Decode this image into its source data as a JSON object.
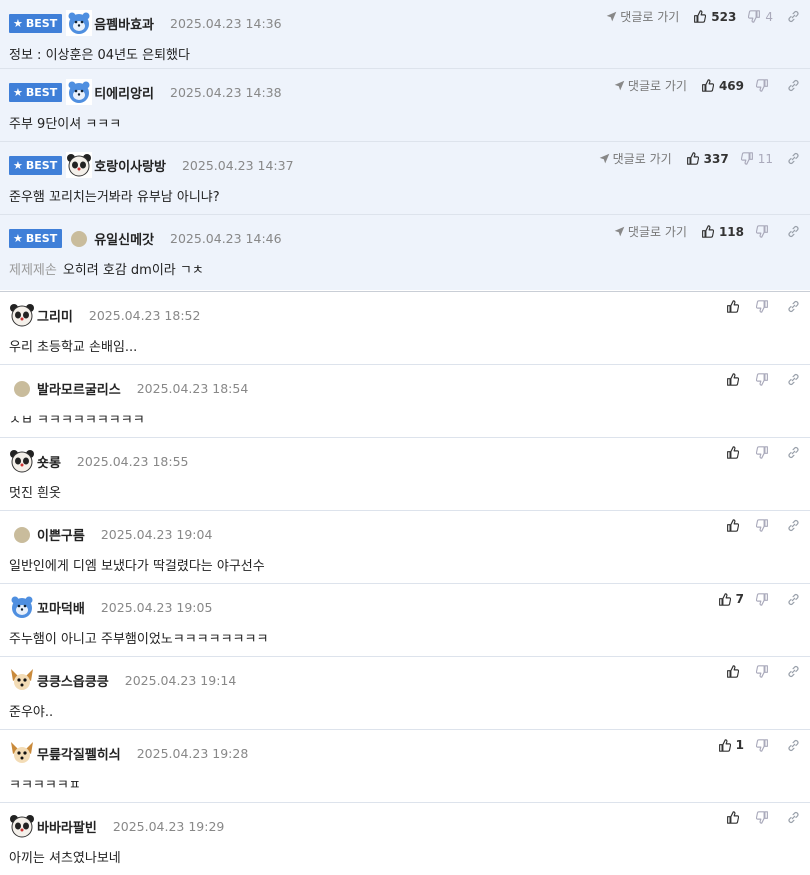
{
  "ui": {
    "best_label": "BEST",
    "goto_label": "댓글로 가기"
  },
  "best_comments": [
    {
      "nick": "음펨바효과",
      "date": "2025.04.23 14:36",
      "text": "정보 : 이상훈은 04년도 은퇴했다",
      "prefix": "",
      "up": "523",
      "down": "4",
      "avatar": "blue-bear"
    },
    {
      "nick": "티에리앙리",
      "date": "2025.04.23 14:38",
      "text": "주부 9단이셔 ㅋㅋㅋ",
      "prefix": "",
      "up": "469",
      "down": "",
      "avatar": "blue-bear"
    },
    {
      "nick": "호랑이사랑방",
      "date": "2025.04.23 14:37",
      "text": "준우햄 꼬리치는거봐라 유부남 아니냐?",
      "prefix": "",
      "up": "337",
      "down": "11",
      "avatar": "panda"
    },
    {
      "nick": "유일신메갓",
      "date": "2025.04.23 14:46",
      "text": "오히려 호감 dm이라 ㄱㅊ",
      "prefix": "제제제손",
      "up": "118",
      "down": "",
      "avatar": "dot"
    }
  ],
  "comments": [
    {
      "nick": "그리미",
      "date": "2025.04.23 18:52",
      "text": "우리 초등학교 손배임...",
      "up": "",
      "avatar": "panda"
    },
    {
      "nick": "발라모르굴리스",
      "date": "2025.04.23 18:54",
      "text": "ㅅㅂ ㅋㅋㅋㅋㅋㅋㅋㅋㅋ",
      "up": "",
      "avatar": "dot"
    },
    {
      "nick": "숏롱",
      "date": "2025.04.23 18:55",
      "text": "멋진 흰옷",
      "up": "",
      "avatar": "panda"
    },
    {
      "nick": "이쁜구름",
      "date": "2025.04.23 19:04",
      "text": "일반인에게 디엠 보냈다가 딱걸렸다는 야구선수",
      "up": "",
      "avatar": "dot"
    },
    {
      "nick": "꼬마덕배",
      "date": "2025.04.23 19:05",
      "text": "주누햄이 아니고 주부햄이었노ㅋㅋㅋㅋㅋㅋㅋㅋ",
      "up": "7",
      "avatar": "blue-bear"
    },
    {
      "nick": "킁킁스읍킁킁",
      "date": "2025.04.23 19:14",
      "text": "준우야..",
      "up": "",
      "avatar": "chihuahua"
    },
    {
      "nick": "무릎각질펠히싀",
      "date": "2025.04.23 19:28",
      "text": "ㅋㅋㅋㅋㅋㅍ",
      "up": "1",
      "avatar": "chihuahua"
    },
    {
      "nick": "바바라팔빈",
      "date": "2025.04.23 19:29",
      "text": "아끼는 셔츠였나보네",
      "up": "",
      "avatar": "panda"
    }
  ],
  "colors": {
    "best_bg": "#eef3fb",
    "badge": "#3f7fd8",
    "border": "#dde3ec"
  }
}
